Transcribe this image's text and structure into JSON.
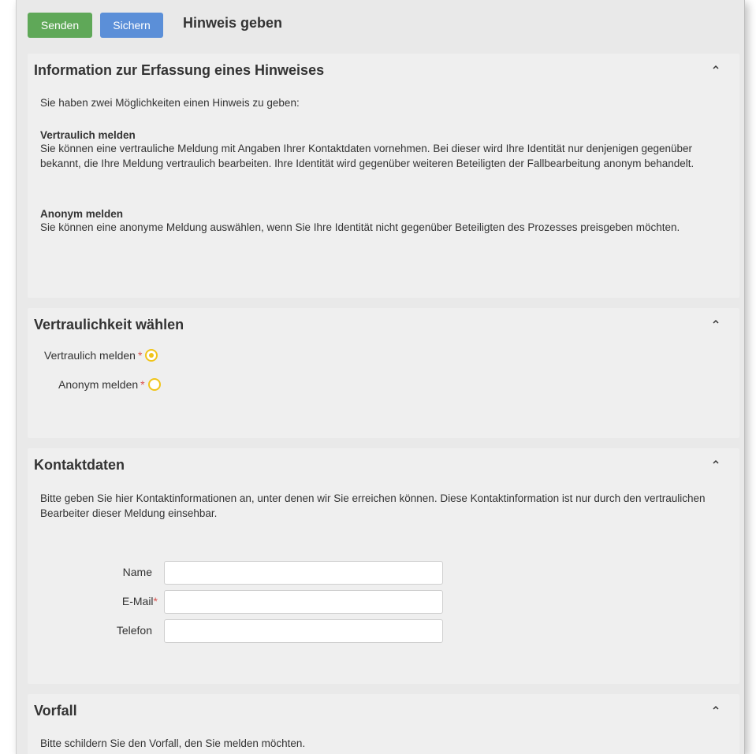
{
  "toolbar": {
    "send_label": "Senden",
    "save_label": "Sichern",
    "title": "Hinweis geben"
  },
  "info_panel": {
    "title": "Information zur Erfassung eines Hinweises",
    "intro": "Sie haben zwei Möglichkeiten einen Hinweis zu geben:",
    "confidential_heading": "Vertraulich melden",
    "confidential_text": "Sie können eine vertrauliche Meldung mit Angaben Ihrer Kontaktdaten vornehmen. Bei dieser wird Ihre Identität nur denjenigen gegenüber bekannt, die Ihre Meldung vertraulich bearbeiten. Ihre Identität wird gegenüber weiteren Beteiligten der Fallbearbeitung anonym behandelt.",
    "anonymous_heading": "Anonym melden",
    "anonymous_text": "Sie können eine anonyme Meldung auswählen, wenn Sie Ihre Identität nicht gegenüber Beteiligten des Prozesses preisgeben möchten."
  },
  "confidentiality_panel": {
    "title": "Vertraulichkeit wählen",
    "options": [
      {
        "label": "Vertraulich melden",
        "required": "*",
        "selected": true
      },
      {
        "label": "Anonym melden",
        "required": "*",
        "selected": false
      }
    ]
  },
  "contact_panel": {
    "title": "Kontaktdaten",
    "description": "Bitte geben Sie hier Kontaktinformationen an, unter denen wir Sie erreichen können. Diese Kontaktinformation ist nur durch den vertraulichen Bearbeiter dieser Meldung einsehbar.",
    "fields": [
      {
        "label": "Name",
        "required": "",
        "value": ""
      },
      {
        "label": "E-Mail",
        "required": "*",
        "value": ""
      },
      {
        "label": "Telefon",
        "required": "",
        "value": ""
      }
    ]
  },
  "incident_panel": {
    "title": "Vorfall",
    "description": "Bitte schildern Sie den Vorfall, den Sie melden möchten."
  },
  "colors": {
    "send_button": "#5fa858",
    "save_button": "#5b8fd8",
    "radio_accent": "#f0c419",
    "required_marker": "#d9534f"
  },
  "icons": {
    "collapse": "chevron-up-icon"
  }
}
